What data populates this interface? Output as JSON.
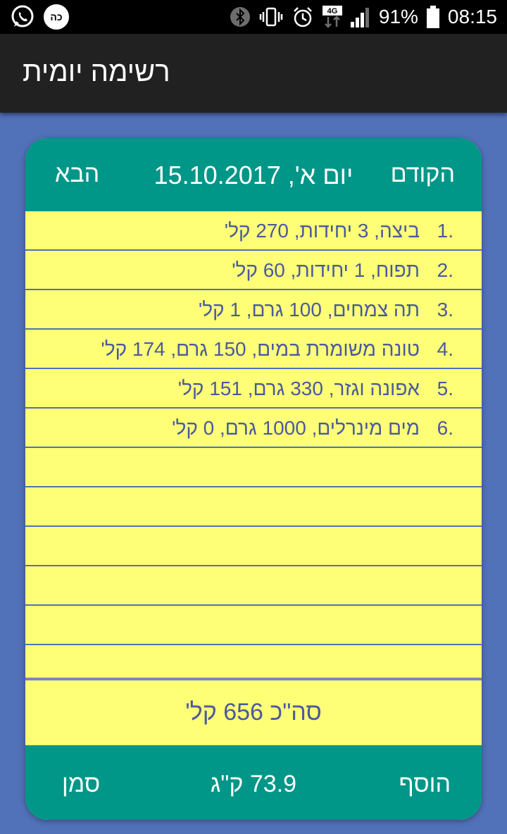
{
  "status_bar": {
    "battery_percent": "91%",
    "time": "08:15",
    "network": "4G",
    "icons": [
      "whatsapp-icon",
      "app-icon",
      "bluetooth-icon",
      "vibrate-icon",
      "alarm-icon",
      "signal-icon",
      "battery-icon"
    ],
    "app_badge": "כה"
  },
  "toolbar": {
    "title": "רשימה יומית"
  },
  "day_nav": {
    "prev_label": "הקודם",
    "date": "יום א', 15.10.2017",
    "next_label": "הבא"
  },
  "items": [
    {
      "num": "1.",
      "text": "ביצה,  3 יחידות, 270 קל'"
    },
    {
      "num": "2.",
      "text": "תפוח,  1 יחידות, 60 קל'"
    },
    {
      "num": "3.",
      "text": "תה צמחים,  100 גרם, 1 קל'"
    },
    {
      "num": "4.",
      "text": "טונה משומרת במים,  150 גרם, 174 קל'"
    },
    {
      "num": "5.",
      "text": "אפונה וגזר,  330 גרם, 151 קל'"
    },
    {
      "num": "6.",
      "text": "מים מינרלים,  1000 גרם, 0 קל'"
    },
    {
      "num": "",
      "text": ""
    },
    {
      "num": "",
      "text": ""
    },
    {
      "num": "",
      "text": ""
    },
    {
      "num": "",
      "text": ""
    },
    {
      "num": "",
      "text": ""
    },
    {
      "num": "",
      "text": ""
    }
  ],
  "total": {
    "label": "סה\"כ 656 קל'"
  },
  "footer": {
    "add_label": "הוסף",
    "weight": "73.9 ק\"ג",
    "mark_label": "סמן"
  },
  "colors": {
    "background": "#5171b9",
    "teal": "#009688",
    "paper": "#ffff77",
    "toolbar": "#212121"
  }
}
